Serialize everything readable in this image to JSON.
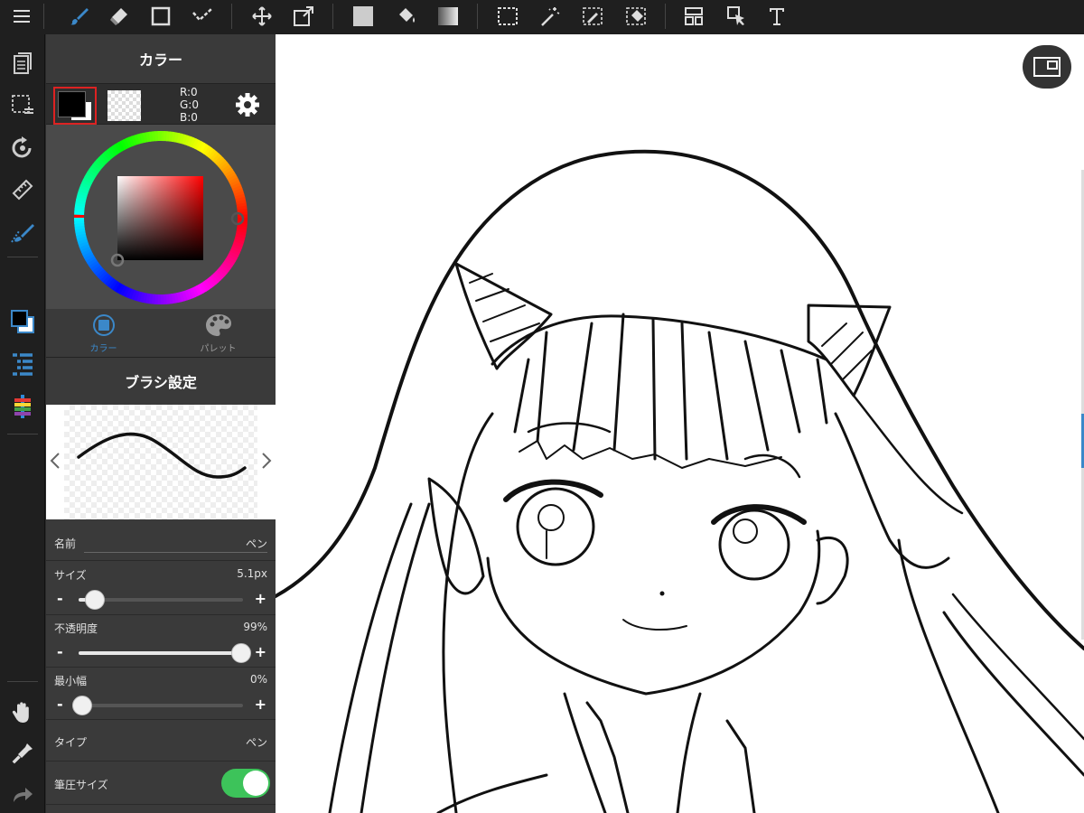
{
  "toolbar": {
    "icons": [
      "menu-icon",
      "brush-icon",
      "eraser-icon",
      "rectangle-icon",
      "dotted-line-icon",
      "move-icon",
      "transform-icon",
      "fill-color-icon",
      "bucket-icon",
      "gradient-icon",
      "select-rect-icon",
      "magic-wand-icon",
      "select-pen-icon",
      "select-eraser-icon",
      "layout-icon",
      "select-arrow-icon",
      "text-icon"
    ]
  },
  "rail": {
    "icons": [
      "pages-icon",
      "selection-icon",
      "rotate-icon",
      "ruler-icon",
      "snap-brush-icon",
      "color-swatch-icon",
      "layers-icon",
      "color-bars-icon",
      "hand-icon",
      "eyedropper-icon",
      "redo-icon"
    ]
  },
  "color_panel": {
    "title": "カラー",
    "r_label": "R:0",
    "g_label": "G:0",
    "b_label": "B:0",
    "foreground": "#000000",
    "tab_color": "カラー",
    "tab_palette": "パレット",
    "accent": "#3b88c9"
  },
  "brush_panel": {
    "title": "ブラシ設定",
    "name_label": "名前",
    "name_value": "ペン",
    "size_label": "サイズ",
    "size_value": "5.1px",
    "size_level": 0.1,
    "opacity_label": "不透明度",
    "opacity_value": "99%",
    "opacity_level": 0.99,
    "minwidth_label": "最小幅",
    "minwidth_value": "0%",
    "minwidth_level": 0.0,
    "type_label": "タイプ",
    "type_value": "ペン",
    "pressure_label": "筆圧サイズ",
    "pressure_on": true,
    "minus": "-",
    "plus": "+"
  }
}
